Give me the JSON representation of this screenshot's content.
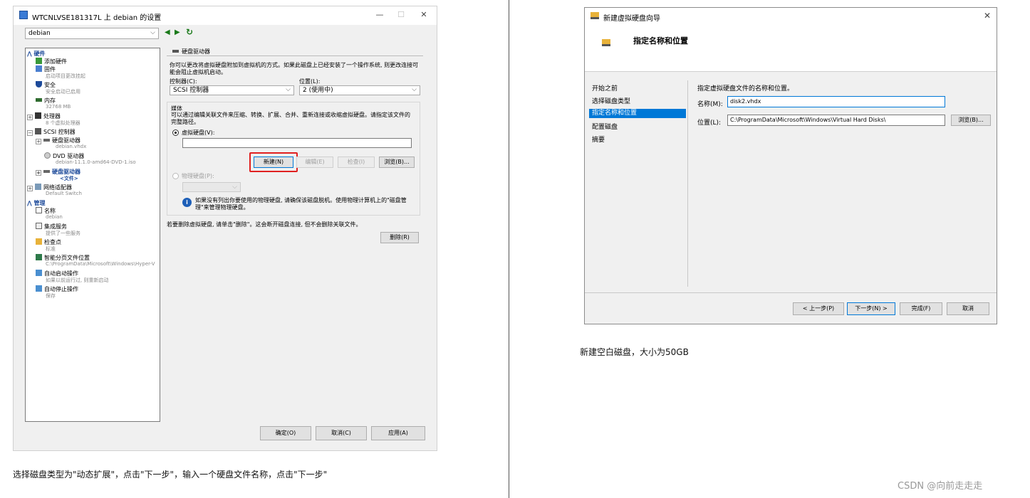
{
  "left": {
    "window_title": "WTCNLVSE181317L 上 debian 的设置",
    "vm_select": "debian",
    "tree": {
      "hardware_header": "硬件",
      "add_hardware": "添加硬件",
      "firmware": "固件",
      "firmware_sub": "启动项目更改挂起",
      "security": "安全",
      "security_sub": "安全启动已启用",
      "memory": "内存",
      "memory_sub": "32768 MB",
      "processor": "处理器",
      "processor_sub": "8 个虚拟处理器",
      "scsi": "SCSI 控制器",
      "hdd": "硬盘驱动器",
      "hdd_sub": "debian.vhdx",
      "dvd": "DVD 驱动器",
      "dvd_sub": "debian-11.1.0-amd64-DVD-1.iso",
      "hdd2": "硬盘驱动器",
      "hdd2_sub": "<文件>",
      "network": "网络适配器",
      "network_sub": "Default Switch",
      "management_header": "管理",
      "name": "名称",
      "name_sub": "debian",
      "integration": "集成服务",
      "integration_sub": "提供了一些服务",
      "checkpoint": "检查点",
      "checkpoint_sub": "标准",
      "paging": "智能分页文件位置",
      "paging_sub": "C:\\ProgramData\\Microsoft\\Windows\\Hyper-V",
      "autostart": "自动启动操作",
      "autostart_sub": "如果以前运行过, 则重新启动",
      "autostop": "自动停止操作",
      "autostop_sub": "保存"
    },
    "panel": {
      "group_title": "硬盘驱动器",
      "desc": "你可以更改将虚拟硬盘附加到虚拟机的方式。如果此磁盘上已经安装了一个操作系统, 则更改连接可能会阻止虚拟机启动。",
      "controller_label": "控制器(C):",
      "controller_value": "SCSI 控制器",
      "location_label": "位置(L):",
      "location_value": "2 (使用中)",
      "media_label": "媒体",
      "media_desc": "可以通过编辑关联文件来压缩、转换、扩展、合并、重新连接或收缩虚拟硬盘。请指定该文件的完整路径。",
      "virtual_disk_label": "虚拟硬盘(V):",
      "virtual_disk_value": "",
      "btn_new": "新建(N)",
      "btn_edit": "编辑(E)",
      "btn_inspect": "检查(I)",
      "btn_browse": "浏览(B)...",
      "physical_disk_label": "物理硬盘(P):",
      "info_text": "如果没有列出你要使用的物理硬盘, 请确保该磁盘脱机。使用物理计算机上的\"磁盘管理\"来管理物理硬盘。",
      "remove_desc": "若要删除虚拟硬盘, 请单击\"删除\"。这会断开磁盘连接, 但不会删除关联文件。",
      "btn_remove": "删除(R)"
    },
    "footer": {
      "ok": "确定(O)",
      "cancel": "取消(C)",
      "apply": "应用(A)"
    },
    "caption": "选择磁盘类型为\"动态扩展\"，点击\"下一步\"，输入一个硬盘文件名称，点击\"下一步\""
  },
  "right": {
    "window_title": "新建虚拟硬盘向导",
    "page_title": "指定名称和位置",
    "steps": [
      "开始之前",
      "选择磁盘类型",
      "指定名称和位置",
      "配置磁盘",
      "摘要"
    ],
    "instruction": "指定虚拟硬盘文件的名称和位置。",
    "name_label": "名称(M):",
    "name_value": "disk2.vhdx",
    "location_label": "位置(L):",
    "location_value": "C:\\ProgramData\\Microsoft\\Windows\\Virtual Hard Disks\\",
    "btn_browse": "浏览(B)...",
    "btn_prev": "< 上一步(P)",
    "btn_next": "下一步(N) >",
    "btn_finish": "完成(F)",
    "btn_cancel": "取消",
    "caption": "新建空白磁盘，大小为50GB"
  },
  "watermark": "CSDN @向前走走走",
  "colors": {
    "selection": "#0078d7",
    "highlight_box": "#e02020",
    "accent_tree": "#1d4a9a"
  }
}
